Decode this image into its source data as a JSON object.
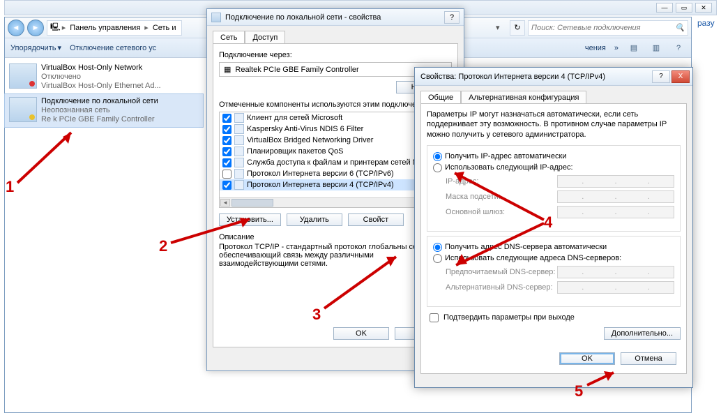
{
  "ghost": {
    "rightText": "разу"
  },
  "explorer": {
    "path": {
      "root": "Панель управления",
      "seg2": "Сеть и"
    },
    "search_placeholder": "Поиск: Сетевые подключения",
    "toolbar": {
      "organize": "Упорядочить",
      "disable": "Отключение сетевого ус",
      "diag": "чения",
      "chevrons": "»"
    },
    "adapters": [
      {
        "name": "VirtualBox Host-Only Network",
        "status": "Отключено",
        "device": "VirtualBox Host-Only Ethernet Ad..."
      },
      {
        "name": "Подключение по локальной сети",
        "status": "Неопознанная сеть",
        "device": "Re    k PCIe GBE Family Controller"
      }
    ]
  },
  "dlg1": {
    "title": "Подключение по локальной сети - свойства",
    "help": "?",
    "tabs": {
      "network": "Сеть",
      "access": "Доступ"
    },
    "connect_label": "Подключение через:",
    "connect_value": "Realtek PCIe GBE Family Controller",
    "configure_btn": "Настро",
    "components_label": "Отмеченные компоненты используются этим подключен",
    "items": [
      {
        "chk": true,
        "text": "Клиент для сетей Microsoft"
      },
      {
        "chk": true,
        "text": "Kaspersky Anti-Virus NDIS 6 Filter"
      },
      {
        "chk": true,
        "text": "VirtualBox Bridged Networking Driver"
      },
      {
        "chk": true,
        "text": "Планировщик пакетов QoS"
      },
      {
        "chk": true,
        "text": "Служба доступа к файлам и принтерам сетей M"
      },
      {
        "chk": false,
        "text": "Протокол Интернета версии 6 (TCP/IPv6)"
      },
      {
        "chk": true,
        "text": "Протокол Интернета версии 4 (TCP/IPv4)"
      }
    ],
    "install_btn": "Установить...",
    "remove_btn": "Удалить",
    "props_btn": "Свойст",
    "desc_title": "Описание",
    "desc_text": "Протокол TCP/IP - стандартный протокол глобальны сетей, обеспечивающий связь между различными взаимодействующими сетями.",
    "ok": "OK",
    "cancel": "От"
  },
  "dlg2": {
    "title": "Свойства: Протокол Интернета версии 4 (TCP/IPv4)",
    "help": "?",
    "close": "X",
    "tabs": {
      "general": "Общие",
      "alt": "Альтернативная конфигурация"
    },
    "info": "Параметры IP могут назначаться автоматически, если сеть поддерживает эту возможность. В противном случае параметры IP можно получить у сетевого администратора.",
    "r_auto_ip": "Получить IP-адрес автоматически",
    "r_manual_ip": "Использовать следующий IP-адрес:",
    "ip_label": "IP-адрес:",
    "mask_label": "Маска подсети:",
    "gw_label": "Основной шлюз:",
    "r_auto_dns": "Получить адрес DNS-сервера автоматически",
    "r_manual_dns": "Использовать следующие адреса DNS-серверов:",
    "dns1_label": "Предпочитаемый DNS-сервер:",
    "dns2_label": "Альтернативный DNS-сервер:",
    "confirm_exit": "Подтвердить параметры при выходе",
    "advanced": "Дополнительно...",
    "ok": "OK",
    "cancel": "Отмена"
  },
  "anno": {
    "n1": "1",
    "n2": "2",
    "n3": "3",
    "n4": "4",
    "n5": "5"
  }
}
